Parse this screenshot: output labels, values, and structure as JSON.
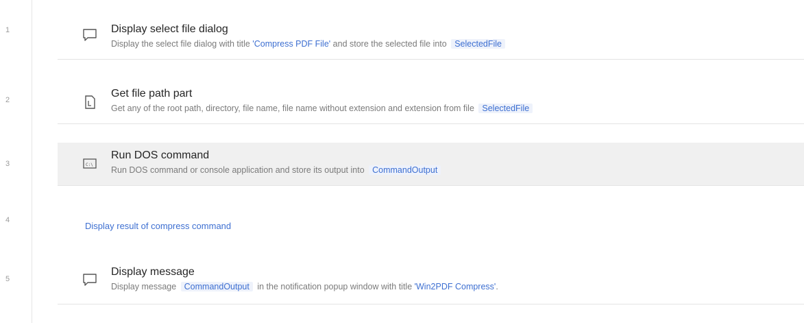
{
  "lines": [
    "1",
    "2",
    "3",
    "4",
    "5"
  ],
  "steps": [
    {
      "title": "Display select file dialog",
      "desc_pre": "Display the select file dialog with title ",
      "desc_hl": "'Compress PDF File'",
      "desc_mid": " and store the selected file into ",
      "var": "SelectedFile",
      "icon": "message-box-icon"
    },
    {
      "title": "Get file path part",
      "desc_pre": "Get any of the root path, directory, file name, file name without extension and extension from file ",
      "var": "SelectedFile",
      "icon": "file-path-icon"
    },
    {
      "title": "Run DOS command",
      "desc_pre": "Run DOS command or console application and store its output into ",
      "var": "CommandOutput",
      "icon": "terminal-icon"
    }
  ],
  "comment": "Display result of compress command",
  "step5": {
    "title": "Display message",
    "desc_pre": "Display message ",
    "var": "CommandOutput",
    "desc_mid": " in the notification popup window with title ",
    "desc_hl": "'Win2PDF Compress'",
    "desc_end": ".",
    "icon": "message-box-icon"
  },
  "colors": {
    "accent": "#3d6fd1",
    "selected_row": "#f0f0f0"
  }
}
